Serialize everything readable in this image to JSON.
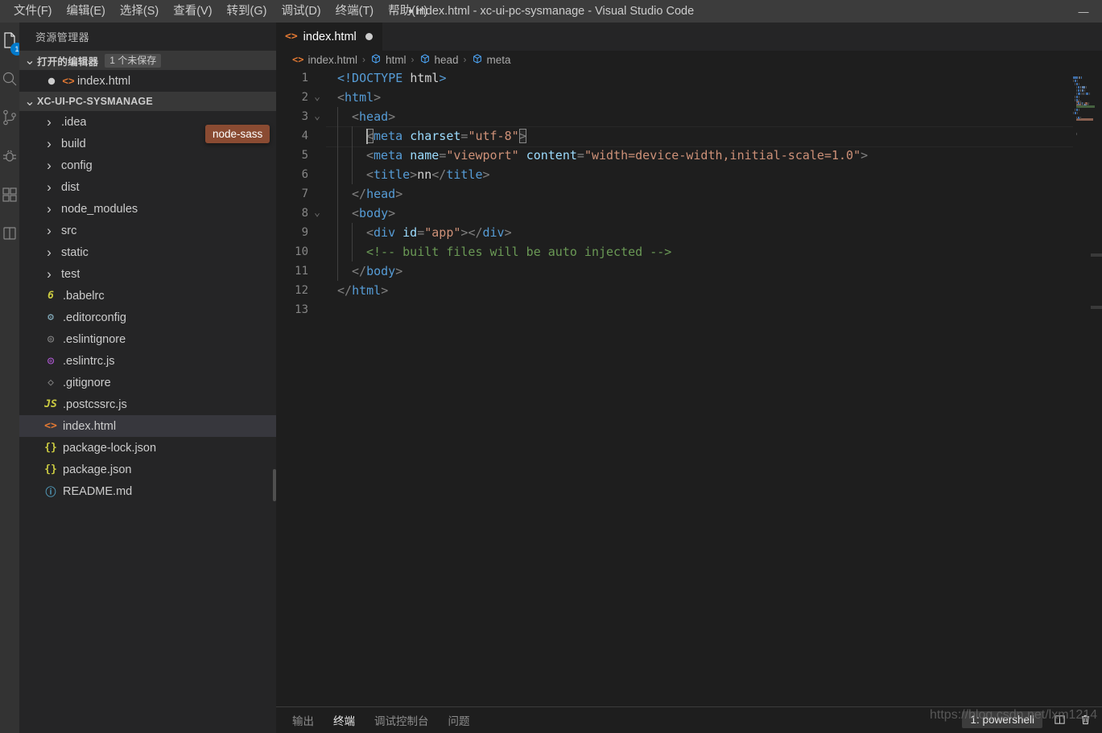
{
  "window": {
    "title": "index.html - xc-ui-pc-sysmanage - Visual Studio Code",
    "dirty_marker": "●",
    "minimize_label": "—"
  },
  "menubar": {
    "items": [
      {
        "label": "文件(F)",
        "name": "menu-file"
      },
      {
        "label": "编辑(E)",
        "name": "menu-edit"
      },
      {
        "label": "选择(S)",
        "name": "menu-selection"
      },
      {
        "label": "查看(V)",
        "name": "menu-view"
      },
      {
        "label": "转到(G)",
        "name": "menu-go"
      },
      {
        "label": "调试(D)",
        "name": "menu-debug"
      },
      {
        "label": "终端(T)",
        "name": "menu-terminal"
      },
      {
        "label": "帮助(H)",
        "name": "menu-help"
      }
    ]
  },
  "activitybar": {
    "items": [
      {
        "name": "explorer",
        "badge": "1",
        "active": true
      },
      {
        "name": "search",
        "badge": "",
        "active": false
      },
      {
        "name": "source-control",
        "badge": "",
        "active": false
      },
      {
        "name": "debug",
        "badge": "",
        "active": false
      },
      {
        "name": "extensions",
        "badge": "",
        "active": false
      },
      {
        "name": "remote",
        "badge": "",
        "active": false
      }
    ]
  },
  "sidebar": {
    "title": "资源管理器",
    "open_editors": {
      "title": "打开的编辑器",
      "badge": "1 个未保存",
      "items": [
        {
          "label": "index.html",
          "icon": "html-file-icon",
          "dirty": true
        }
      ]
    },
    "project": {
      "title": "XC-UI-PC-SYSMANAGE",
      "items": [
        {
          "label": ".idea",
          "type": "folder",
          "icon": "chevron-right-icon"
        },
        {
          "label": "build",
          "type": "folder",
          "icon": "chevron-right-icon"
        },
        {
          "label": "config",
          "type": "folder",
          "icon": "chevron-right-icon"
        },
        {
          "label": "dist",
          "type": "folder",
          "icon": "chevron-right-icon"
        },
        {
          "label": "node_modules",
          "type": "folder",
          "icon": "chevron-right-icon"
        },
        {
          "label": "src",
          "type": "folder",
          "icon": "chevron-right-icon"
        },
        {
          "label": "static",
          "type": "folder",
          "icon": "chevron-right-icon"
        },
        {
          "label": "test",
          "type": "folder",
          "icon": "chevron-right-icon"
        },
        {
          "label": ".babelrc",
          "type": "file",
          "icon": "babel-icon",
          "glyph": "6",
          "color": "#cbcb41"
        },
        {
          "label": ".editorconfig",
          "type": "file",
          "icon": "gear-icon",
          "glyph": "⚙",
          "color": "#8bb7c8"
        },
        {
          "label": ".eslintignore",
          "type": "file",
          "icon": "eslint-gray-icon",
          "glyph": "◎",
          "color": "#8a8a8a"
        },
        {
          "label": ".eslintrc.js",
          "type": "file",
          "icon": "eslint-icon",
          "glyph": "◎",
          "color": "#b55bdb"
        },
        {
          "label": ".gitignore",
          "type": "file",
          "icon": "git-icon",
          "glyph": "◇",
          "color": "#7c7c7c"
        },
        {
          "label": ".postcssrc.js",
          "type": "file",
          "icon": "js-icon",
          "glyph": "JS",
          "color": "#cbcb41"
        },
        {
          "label": "index.html",
          "type": "file",
          "icon": "html-file-icon",
          "glyph": "<>",
          "color": "#e37933",
          "selected": true
        },
        {
          "label": "package-lock.json",
          "type": "file",
          "icon": "json-icon",
          "glyph": "{}",
          "color": "#cbcb41"
        },
        {
          "label": "package.json",
          "type": "file",
          "icon": "json-icon",
          "glyph": "{}",
          "color": "#cbcb41"
        },
        {
          "label": "README.md",
          "type": "file",
          "icon": "markdown-icon",
          "glyph": "ⓘ",
          "color": "#519aba"
        }
      ]
    },
    "tooltip": "node-sass"
  },
  "editor": {
    "tabs": [
      {
        "label": "index.html",
        "icon": "html-file-icon",
        "dirty": true,
        "active": true
      }
    ],
    "breadcrumbs": [
      {
        "label": "index.html",
        "icon": "html-file-icon"
      },
      {
        "label": "html",
        "icon": "symbol-field-icon"
      },
      {
        "label": "head",
        "icon": "symbol-field-icon"
      },
      {
        "label": "meta",
        "icon": "symbol-field-icon"
      }
    ],
    "separator": "›",
    "cursor_line": 4,
    "lines": [
      {
        "n": "1",
        "fold": "",
        "indent": 0,
        "tokens": [
          {
            "t": "<!DOCTYPE ",
            "c": "doctype"
          },
          {
            "t": "html",
            "c": "text"
          },
          {
            "t": ">",
            "c": "doctype"
          }
        ]
      },
      {
        "n": "2",
        "fold": "chevron-down",
        "indent": 0,
        "tokens": [
          {
            "t": "<",
            "c": "punc"
          },
          {
            "t": "html",
            "c": "tag"
          },
          {
            "t": ">",
            "c": "punc"
          }
        ]
      },
      {
        "n": "3",
        "fold": "chevron-down",
        "indent": 1,
        "tokens": [
          {
            "t": "<",
            "c": "punc"
          },
          {
            "t": "head",
            "c": "tag"
          },
          {
            "t": ">",
            "c": "punc"
          }
        ]
      },
      {
        "n": "4",
        "fold": "",
        "indent": 2,
        "current": true,
        "tokens": [
          {
            "t": "<",
            "c": "punc",
            "match": true
          },
          {
            "t": "meta",
            "c": "tag"
          },
          {
            "t": " ",
            "c": "text"
          },
          {
            "t": "charset",
            "c": "attr"
          },
          {
            "t": "=",
            "c": "punc"
          },
          {
            "t": "\"utf-8\"",
            "c": "str"
          },
          {
            "t": ">",
            "c": "punc",
            "match": true
          }
        ]
      },
      {
        "n": "5",
        "fold": "",
        "indent": 2,
        "tokens": [
          {
            "t": "<",
            "c": "punc"
          },
          {
            "t": "meta",
            "c": "tag"
          },
          {
            "t": " ",
            "c": "text"
          },
          {
            "t": "name",
            "c": "attr"
          },
          {
            "t": "=",
            "c": "punc"
          },
          {
            "t": "\"viewport\"",
            "c": "str"
          },
          {
            "t": " ",
            "c": "text"
          },
          {
            "t": "content",
            "c": "attr"
          },
          {
            "t": "=",
            "c": "punc"
          },
          {
            "t": "\"width=device-width,initial-scale=1.0\"",
            "c": "str"
          },
          {
            "t": ">",
            "c": "punc"
          }
        ]
      },
      {
        "n": "6",
        "fold": "",
        "indent": 2,
        "tokens": [
          {
            "t": "<",
            "c": "punc"
          },
          {
            "t": "title",
            "c": "tag"
          },
          {
            "t": ">",
            "c": "punc"
          },
          {
            "t": "nn",
            "c": "text"
          },
          {
            "t": "</",
            "c": "punc"
          },
          {
            "t": "title",
            "c": "tag"
          },
          {
            "t": ">",
            "c": "punc"
          }
        ]
      },
      {
        "n": "7",
        "fold": "",
        "indent": 1,
        "tokens": [
          {
            "t": "</",
            "c": "punc"
          },
          {
            "t": "head",
            "c": "tag"
          },
          {
            "t": ">",
            "c": "punc"
          }
        ]
      },
      {
        "n": "8",
        "fold": "chevron-down",
        "indent": 1,
        "tokens": [
          {
            "t": "<",
            "c": "punc"
          },
          {
            "t": "body",
            "c": "tag"
          },
          {
            "t": ">",
            "c": "punc"
          }
        ]
      },
      {
        "n": "9",
        "fold": "",
        "indent": 2,
        "tokens": [
          {
            "t": "<",
            "c": "punc"
          },
          {
            "t": "div",
            "c": "tag"
          },
          {
            "t": " ",
            "c": "text"
          },
          {
            "t": "id",
            "c": "attr"
          },
          {
            "t": "=",
            "c": "punc"
          },
          {
            "t": "\"app\"",
            "c": "str"
          },
          {
            "t": ">",
            "c": "punc"
          },
          {
            "t": "</",
            "c": "punc"
          },
          {
            "t": "div",
            "c": "tag"
          },
          {
            "t": ">",
            "c": "punc"
          }
        ]
      },
      {
        "n": "10",
        "fold": "",
        "indent": 2,
        "tokens": [
          {
            "t": "<!-- built files will be auto injected -->",
            "c": "comment"
          }
        ]
      },
      {
        "n": "11",
        "fold": "",
        "indent": 1,
        "tokens": [
          {
            "t": "</",
            "c": "punc"
          },
          {
            "t": "body",
            "c": "tag"
          },
          {
            "t": ">",
            "c": "punc"
          }
        ]
      },
      {
        "n": "12",
        "fold": "",
        "indent": 0,
        "tokens": [
          {
            "t": "</",
            "c": "punc"
          },
          {
            "t": "html",
            "c": "tag"
          },
          {
            "t": ">",
            "c": "punc"
          }
        ]
      },
      {
        "n": "13",
        "fold": "",
        "indent": 0,
        "tokens": []
      }
    ]
  },
  "panel": {
    "tabs": [
      {
        "label": "输出",
        "name": "panel-tab-output",
        "active": false
      },
      {
        "label": "终端",
        "name": "panel-tab-terminal",
        "active": true
      },
      {
        "label": "调试控制台",
        "name": "panel-tab-debug-console",
        "active": false
      },
      {
        "label": "问题",
        "name": "panel-tab-problems",
        "active": false
      }
    ],
    "terminal_select": "1: powershell",
    "split_icon": "split-terminal-icon",
    "kill_icon": "trash-icon"
  },
  "watermark": "https://blog.csdn.net/lxm1214",
  "colors": {
    "titlebar_bg": "#3c3c3c",
    "activitybar_bg": "#333333",
    "sidebar_bg": "#252526",
    "editor_bg": "#1e1e1e",
    "accent": "#007acc",
    "tooltip_bg": "#8a4b32",
    "html_icon": "#e37933",
    "selection_bg": "#37373d"
  }
}
